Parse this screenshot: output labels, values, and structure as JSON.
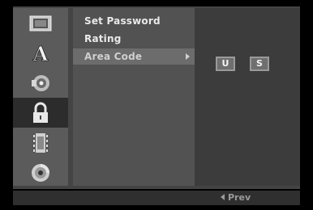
{
  "sidebar": {
    "icons": [
      {
        "name": "display-icon"
      },
      {
        "name": "language-icon",
        "glyph": "A"
      },
      {
        "name": "audio-icon"
      },
      {
        "name": "lock-icon",
        "selected": true
      },
      {
        "name": "recording-icon"
      },
      {
        "name": "disc-icon"
      }
    ]
  },
  "menu": {
    "items": [
      {
        "label": "Set Password"
      },
      {
        "label": "Rating"
      },
      {
        "label": "Area Code",
        "selected": true
      }
    ]
  },
  "area_code": {
    "letters": [
      "U",
      "S"
    ]
  },
  "footer": {
    "prev_label": "Prev"
  },
  "colors": {
    "background": "#000000",
    "icon_column": "#5b5b5b",
    "menu_panel": "#525252",
    "right_panel": "#3c3c3c",
    "selection": "#6c6c6c",
    "text": "#e9e9e9"
  }
}
